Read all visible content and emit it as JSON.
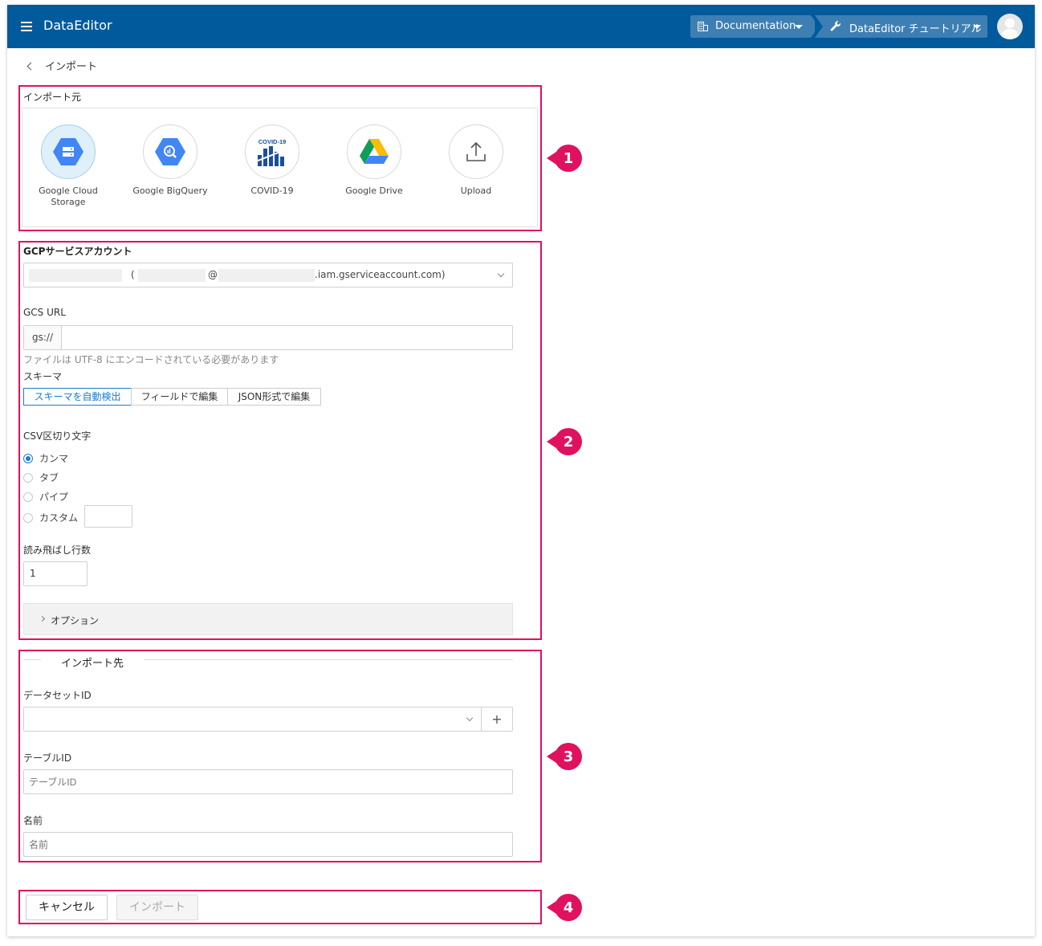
{
  "header": {
    "app_title": "DataEditor",
    "breadcrumb_project": "Documentation",
    "breadcrumb_workspace": "DataEditor チュートリアル"
  },
  "page": {
    "title": "インポート"
  },
  "source": {
    "section_label": "インポート元",
    "options": [
      {
        "name": "Google Cloud Storage",
        "icon": "gcs-icon",
        "selected": true
      },
      {
        "name": "Google BigQuery",
        "icon": "bigquery-icon",
        "selected": false
      },
      {
        "name": "COVID-19",
        "icon": "covid19-icon",
        "selected": false
      },
      {
        "name": "Google Drive",
        "icon": "google-drive-icon",
        "selected": false
      },
      {
        "name": "Upload",
        "icon": "upload-icon",
        "selected": false
      }
    ]
  },
  "gcs": {
    "account_label": "GCPサービスアカウント",
    "account_value_paren_open": "(",
    "account_value_at": "@",
    "account_value_domain": ".iam.gserviceaccount.com)",
    "url_label": "GCS URL",
    "url_prefix": "gs://",
    "url_hint": "ファイルは UTF-8 にエンコードされている必要があります",
    "schema_label": "スキーマ",
    "schema_tabs": [
      "スキーマを自動検出",
      "フィールドで編集",
      "JSON形式で編集"
    ],
    "delimiter_label": "CSV区切り文字",
    "delimiters": [
      "カンマ",
      "タブ",
      "パイプ",
      "カスタム"
    ],
    "skip_rows_label": "読み飛ばし行数",
    "skip_rows_value": "1",
    "options_label": "オプション"
  },
  "destination": {
    "section_label": "インポート先",
    "dataset_label": "データセットID",
    "add_symbol": "+",
    "table_label": "テーブルID",
    "table_placeholder": "テーブルID",
    "name_label": "名前",
    "name_placeholder": "名前"
  },
  "actions": {
    "cancel": "キャンセル",
    "import": "インポート"
  },
  "callouts": [
    "1",
    "2",
    "3",
    "4"
  ],
  "colors": {
    "header": "#005a9c",
    "accent": "#1a7bc9",
    "callout": "#e0115f"
  }
}
